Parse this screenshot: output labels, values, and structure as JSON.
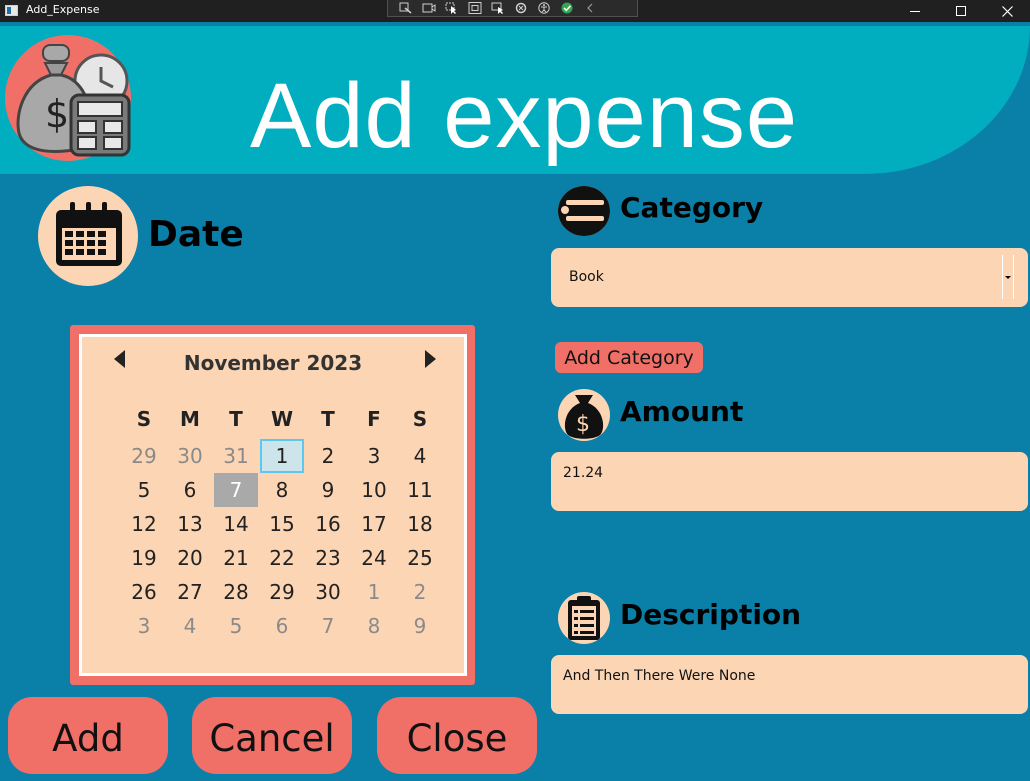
{
  "window": {
    "title": "Add_Expense",
    "controls": [
      "minimize-icon",
      "maximize-icon",
      "close-icon"
    ],
    "debug_toolbar_icons": [
      "live-visual-tree-icon",
      "record-icon",
      "select-element-icon",
      "display-layout-adorners-icon",
      "track-focus-icon",
      "hot-reload-icon",
      "accessibility-icon",
      "binding-status-icon",
      "collapse-icon"
    ]
  },
  "header": {
    "title": "Add expense",
    "icon": "money-bag-calculator-icon"
  },
  "date_section": {
    "label": "Date",
    "icon": "calendar-icon"
  },
  "calendar": {
    "month_label": "November 2023",
    "days_of_week": [
      "S",
      "M",
      "T",
      "W",
      "T",
      "F",
      "S"
    ],
    "weeks": [
      [
        {
          "d": "29",
          "o": true
        },
        {
          "d": "30",
          "o": true
        },
        {
          "d": "31",
          "o": true
        },
        {
          "d": "1",
          "today": true
        },
        {
          "d": "2"
        },
        {
          "d": "3"
        },
        {
          "d": "4"
        }
      ],
      [
        {
          "d": "5"
        },
        {
          "d": "6"
        },
        {
          "d": "7",
          "selected": true
        },
        {
          "d": "8"
        },
        {
          "d": "9"
        },
        {
          "d": "10"
        },
        {
          "d": "11"
        }
      ],
      [
        {
          "d": "12"
        },
        {
          "d": "13"
        },
        {
          "d": "14"
        },
        {
          "d": "15"
        },
        {
          "d": "16"
        },
        {
          "d": "17"
        },
        {
          "d": "18"
        }
      ],
      [
        {
          "d": "19"
        },
        {
          "d": "20"
        },
        {
          "d": "21"
        },
        {
          "d": "22"
        },
        {
          "d": "23"
        },
        {
          "d": "24"
        },
        {
          "d": "25"
        }
      ],
      [
        {
          "d": "26"
        },
        {
          "d": "27"
        },
        {
          "d": "28"
        },
        {
          "d": "29"
        },
        {
          "d": "30"
        },
        {
          "d": "1",
          "o": true
        },
        {
          "d": "2",
          "o": true
        }
      ],
      [
        {
          "d": "3",
          "o": true
        },
        {
          "d": "4",
          "o": true
        },
        {
          "d": "5",
          "o": true
        },
        {
          "d": "6",
          "o": true
        },
        {
          "d": "7",
          "o": true
        },
        {
          "d": "8",
          "o": true
        },
        {
          "d": "9",
          "o": true
        }
      ]
    ]
  },
  "category": {
    "label": "Category",
    "icon": "list-icon",
    "selected_value": "Book",
    "add_button_label": "Add Category"
  },
  "amount": {
    "label": "Amount",
    "icon": "money-bag-icon",
    "value": "21.24"
  },
  "description": {
    "label": "Description",
    "icon": "clipboard-icon",
    "value": "And Then There Were None"
  },
  "actions": {
    "add_label": "Add",
    "cancel_label": "Cancel",
    "close_label": "Close"
  },
  "colors": {
    "background": "#0a7fa8",
    "header": "#00aec0",
    "accent": "#f07068",
    "field": "#fcd6b4",
    "today_border": "#5bc8f0",
    "selected_day": "#a9a9a9"
  }
}
